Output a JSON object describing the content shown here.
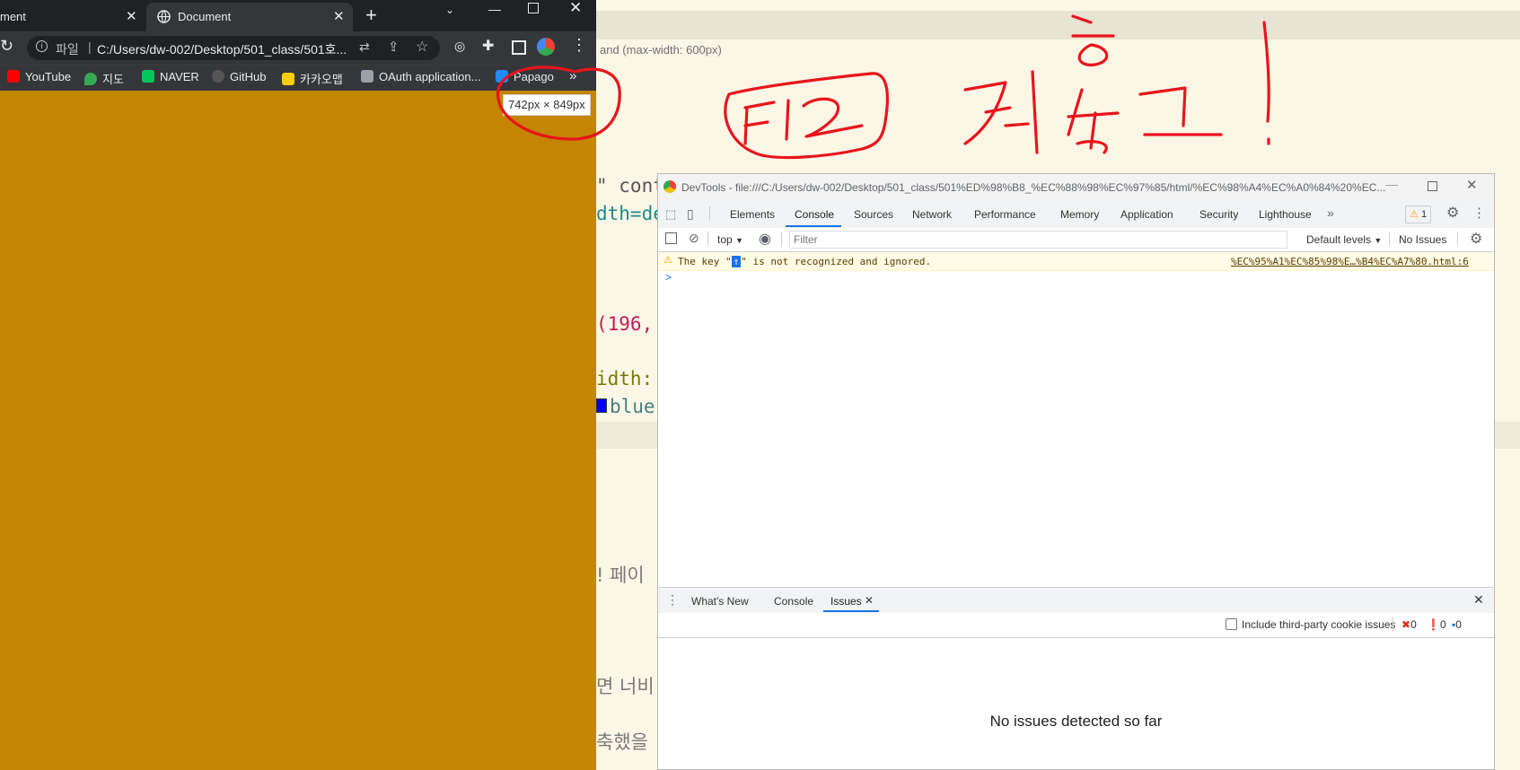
{
  "background_editor": {
    "media_query_text": "and (max-width: 600px)",
    "code_line_1": "\" conte",
    "code_line_2": "dth=de",
    "code_line_3": "(196,",
    "code_line_4": "idth:",
    "code_line_5": "blue",
    "korean_line_1": "! 페이",
    "korean_line_2": "면 너비",
    "korean_line_3": "축했을"
  },
  "browser": {
    "tabs": [
      {
        "title": "ment"
      },
      {
        "title": "Document"
      }
    ],
    "new_tab_symbol": "+",
    "address": {
      "scheme_label": "파일",
      "url": "C:/Users/dw-002/Desktop/501_class/501호..."
    },
    "bookmarks": [
      {
        "label": "YouTube",
        "color": "#ff0000"
      },
      {
        "label": "지도",
        "color": "#34a853"
      },
      {
        "label": "NAVER",
        "color": "#03c75a"
      },
      {
        "label": "GitHub",
        "color": "#555555"
      },
      {
        "label": "카카오맵",
        "color": "#ffcd00"
      },
      {
        "label": "OAuth application...",
        "color": "#9aa0a6"
      },
      {
        "label": "Papago",
        "color": "#1f8bff"
      }
    ],
    "more_bookmarks": "»",
    "viewport_size_badge": "742px × 849px",
    "page_background_color": "#c48500"
  },
  "annotation": {
    "handwritten_text": "F12 켜놓고!",
    "ink_color": "#e8141c"
  },
  "devtools": {
    "title": "DevTools - file:///C:/Users/dw-002/Desktop/501_class/501%ED%98%B8_%EC%88%98%EC%97%85/html/%EC%98%A4%EC%A0%84%20%EC...",
    "panels": [
      "Elements",
      "Console",
      "Sources",
      "Network",
      "Performance",
      "Memory",
      "Application",
      "Security",
      "Lighthouse"
    ],
    "active_panel": "Console",
    "warning_count": "1",
    "context": "top",
    "filter_placeholder": "Filter",
    "levels": "Default levels",
    "issues_button": "No Issues",
    "warning_message_prefix": "The key \"",
    "warning_key_glyph": "↑",
    "warning_message_suffix": "\" is not recognized and ignored.",
    "warning_source": "%EC%95%A1%EC%85%98%E…%B4%EC%A7%80.html:6",
    "prompt_symbol": ">",
    "drawer_tabs": [
      "What's New",
      "Console",
      "Issues"
    ],
    "active_drawer_tab": "Issues",
    "include_third_party_label": "Include third-party cookie issues",
    "issue_counts": {
      "errors": "0",
      "warnings": "0",
      "info": "0"
    },
    "empty_message": "No issues detected so far"
  }
}
